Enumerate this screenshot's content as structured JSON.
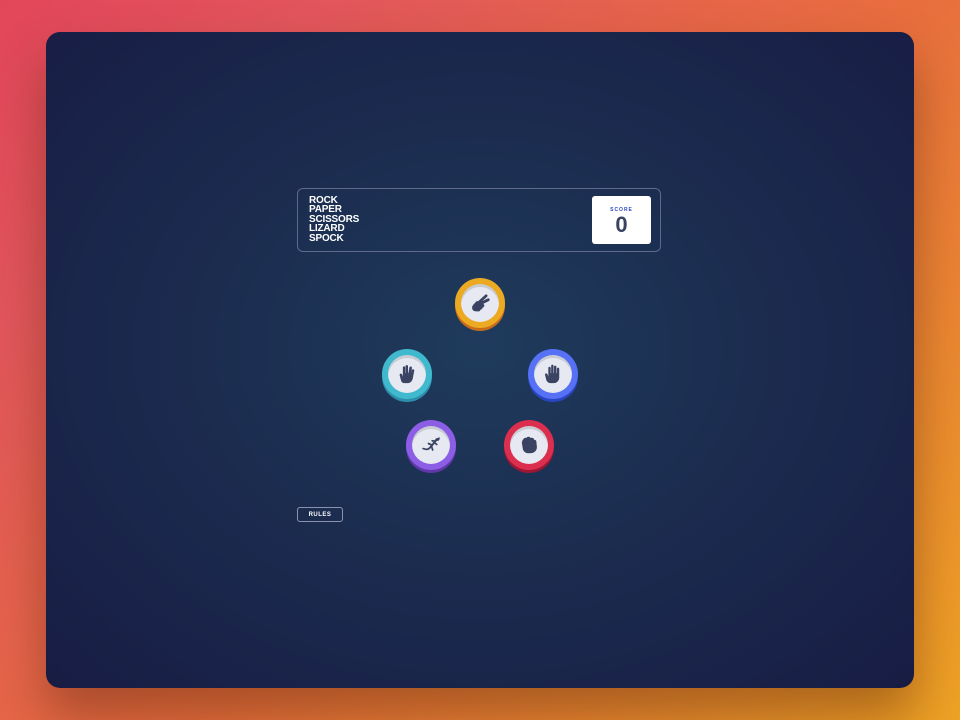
{
  "header": {
    "title_lines": [
      "ROCK",
      "PAPER",
      "SCISSORS",
      "LIZARD",
      "SPOCK"
    ]
  },
  "score": {
    "label": "SCORE",
    "value": "0"
  },
  "choices": [
    {
      "name": "scissors",
      "icon": "scissors-hand-icon",
      "color": "#eca922"
    },
    {
      "name": "spock",
      "icon": "spock-hand-icon",
      "color": "#40b9ce"
    },
    {
      "name": "paper",
      "icon": "paper-hand-icon",
      "color": "#5671f5"
    },
    {
      "name": "lizard",
      "icon": "lizard-icon",
      "color": "#8c5de5"
    },
    {
      "name": "rock",
      "icon": "rock-fist-icon",
      "color": "#dc2e4e"
    }
  ],
  "rules_button": {
    "label": "RULES"
  },
  "colors": {
    "background_gradient_start": "#e2465a",
    "background_gradient_end": "#eea324",
    "panel_dark": "#181c44",
    "panel_center": "#1f3b5c",
    "header_outline": "#5e6a8a",
    "score_text": "#3b4363"
  }
}
